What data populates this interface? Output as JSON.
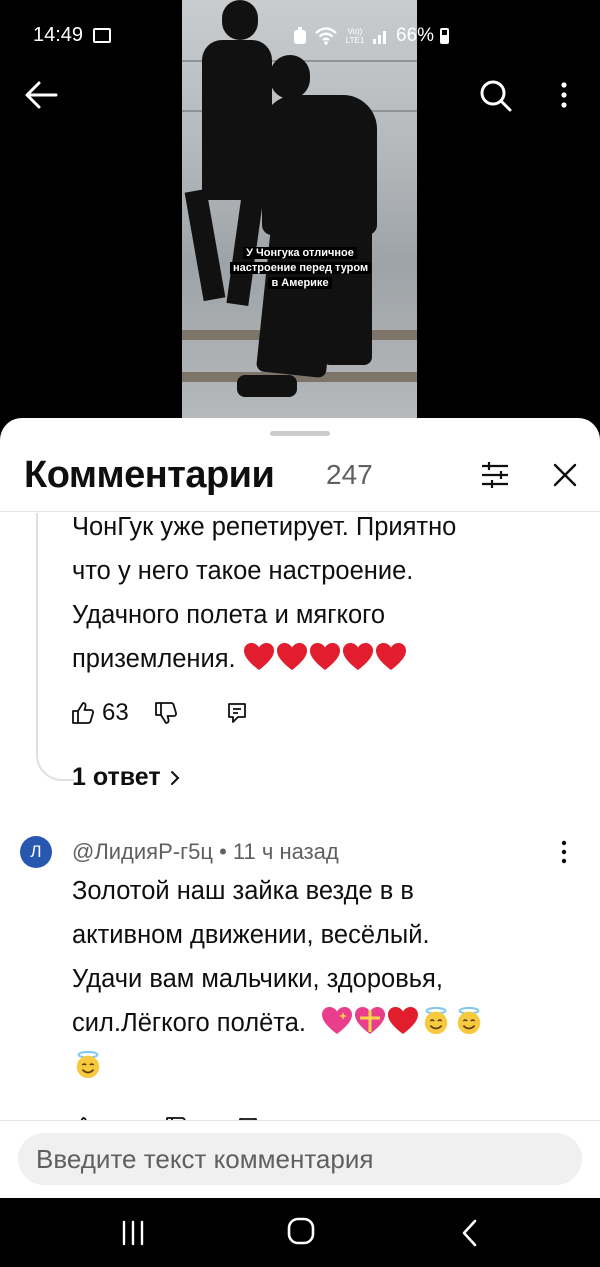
{
  "status_bar": {
    "time": "14:49",
    "network_label": "Vo)) LTE1",
    "battery": "66%"
  },
  "video": {
    "caption": "У Чонгука отличное настроение перед туром в Америке"
  },
  "comments_sheet": {
    "title": "Комментарии",
    "count": "247"
  },
  "first_comment": {
    "text_lines": [
      "ЧонГук уже репетирует. Приятно",
      "что у него такое настроение.",
      "Удачного полета и мягкого",
      "приземления."
    ],
    "emojis": [
      "red-heart",
      "red-heart",
      "red-heart",
      "red-heart",
      "red-heart"
    ],
    "likes": "63",
    "replies_label": "1 ответ"
  },
  "second_comment": {
    "avatar_letter": "Л",
    "author": "@ЛидияР-г5ц",
    "separator": "•",
    "time": "11 ч назад",
    "text_lines": [
      "Золотой наш зайка везде в в",
      "активном движении, весёлый.",
      "Удачи вам мальчики, здоровья,",
      "сил.Лёгкого полёта."
    ],
    "emojis": [
      "sparkling-heart",
      "heart-with-ribbon",
      "red-heart",
      "smiling-face-with-halo",
      "smiling-face-with-halo",
      "smiling-face-with-halo"
    ]
  },
  "input": {
    "placeholder": "Введите текст комментария"
  },
  "colors": {
    "accent_avatar": "#2857b0",
    "heart": "#e11d2e",
    "text_primary": "#0f0f0f",
    "text_secondary": "#606060"
  }
}
